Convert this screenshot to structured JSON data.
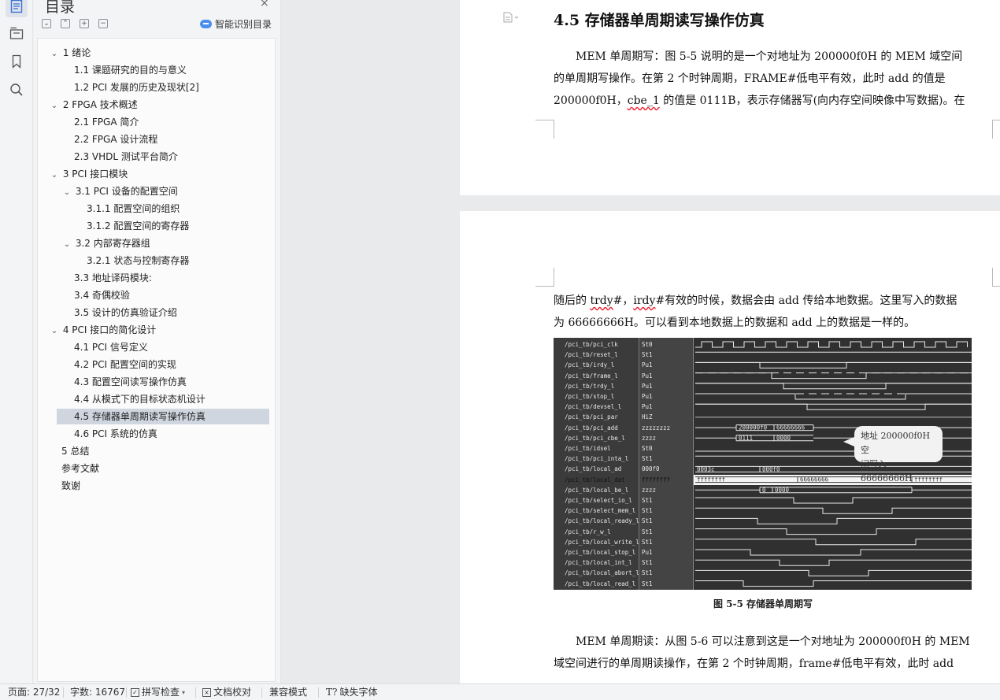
{
  "toc": {
    "title": "目录",
    "close_icon": "×",
    "smart_toc_label": "智能识别目录",
    "tools": [
      "collapse-all",
      "expand-all",
      "add-item",
      "remove-item"
    ],
    "items": [
      {
        "label": "1  绪论",
        "level": 0,
        "expanded": true
      },
      {
        "label": "1.1 课题研究的目的与意义",
        "level": 1
      },
      {
        "label": "1.2 PCI 发展的历史及现状[2]",
        "level": 1
      },
      {
        "label": "2 FPGA 技术概述",
        "level": 0,
        "expanded": true
      },
      {
        "label": "2.1 FPGA 简介",
        "level": 1
      },
      {
        "label": "2.2 FPGA 设计流程",
        "level": 1
      },
      {
        "label": "2.3 VHDL 测试平台简介",
        "level": 1
      },
      {
        "label": "3 PCI 接口模块",
        "level": 0,
        "expanded": true
      },
      {
        "label": "3.1 PCI 设备的配置空间",
        "level": 1,
        "expanded": true
      },
      {
        "label": "3.1.1  配置空间的组织",
        "level": 2
      },
      {
        "label": "3.1.2  配置空间的寄存器",
        "level": 2
      },
      {
        "label": "3.2  内部寄存器组",
        "level": 1,
        "expanded": true
      },
      {
        "label": "3.2.1 状态与控制寄存器",
        "level": 2
      },
      {
        "label": "3.3  地址译码模块:",
        "level": 1
      },
      {
        "label": "3.4    奇偶校验",
        "level": 1
      },
      {
        "label": "3.5 设计的仿真验证介绍",
        "level": 1
      },
      {
        "label": "4 PCI 接口的简化设计",
        "level": 0,
        "expanded": true
      },
      {
        "label": "4.1 PCI 信号定义",
        "level": 1
      },
      {
        "label": "4.2 PCI 配置空间的实现",
        "level": 1
      },
      {
        "label": "4.3  配置空间读写操作仿真",
        "level": 1
      },
      {
        "label": "4.4  从模式下的目标状态机设计",
        "level": 1
      },
      {
        "label": "4.5  存储器单周期读写操作仿真",
        "level": 1,
        "selected": true
      },
      {
        "label": "4.6 PCI 系统的仿真",
        "level": 1
      },
      {
        "label": "5  总结",
        "level": 0
      },
      {
        "label": "参考文献",
        "level": 0
      },
      {
        "label": "致谢",
        "level": 0
      }
    ]
  },
  "rail": {
    "icons": [
      "toc-icon",
      "navigation-icon",
      "bookmark-icon",
      "search-icon"
    ]
  },
  "doc": {
    "section_heading": "4.5  存储器单周期读写操作仿真",
    "para1": [
      "MEM 单周期写：图 5-5 说明的是一个对地址为 200000f0H 的 MEM 域空间",
      "的单周期写操作。在第 2 个时钟周期，FRAME#低电平有效，此时 add 的值是",
      "200000f0H，cbe_1 的值是  0111B，表示存储器写(向内存空间映像中写数据)。在"
    ],
    "para2": [
      "随后的 trdy#，irdy#有效的时候，数据会由 add 传给本地数据。这里写入的数据",
      "为 66666666H。可以看到本地数据上的数据和 add 上的数据是一样的。"
    ],
    "figure_caption": "图 5-5   存储器单周期写",
    "callout": [
      "地址  200000f0H  空",
      "间写入 66666666H"
    ],
    "para3": [
      "MEM 单周期读：从图 5-6 可以注意到这是一个对地址为 200000f0H 的 MEM",
      "域空间进行的单周期读操作，在第 2 个时钟周期，frame#低电平有效，此时 add"
    ],
    "signals": [
      {
        "name": "/pci_tb/pci_clk",
        "value": "St0"
      },
      {
        "name": "/pci_tb/reset_l",
        "value": "St1"
      },
      {
        "name": "/pci_tb/irdy_l",
        "value": "Pu1"
      },
      {
        "name": "/pci_tb/frame_l",
        "value": "Pu1"
      },
      {
        "name": "/pci_tb/trdy_l",
        "value": "Pu1"
      },
      {
        "name": "/pci_tb/stop_l",
        "value": "Pu1"
      },
      {
        "name": "/pci_tb/devsel_l",
        "value": "Pu1"
      },
      {
        "name": "/pci_tb/pci_par",
        "value": "HiZ"
      },
      {
        "name": "/pci_tb/pci_add",
        "value": "zzzzzzzz"
      },
      {
        "name": "/pci_tb/pci_cbe_l",
        "value": "zzzz"
      },
      {
        "name": "/pci_tb/idsel",
        "value": "St0"
      },
      {
        "name": "/pci_tb/pci_inta_l",
        "value": "St1"
      },
      {
        "name": "/pci_tb/local_ad",
        "value": "000f0"
      },
      {
        "name": "/pci_tb/local_dat",
        "value": "ffffffff",
        "highlight": true
      },
      {
        "name": "/pci_tb/local_be_l",
        "value": "zzzz"
      },
      {
        "name": "/pci_tb/select_io_l",
        "value": "St1"
      },
      {
        "name": "/pci_tb/select_mem_l",
        "value": "St1"
      },
      {
        "name": "/pci_tb/local_ready_l",
        "value": "St1"
      },
      {
        "name": "/pci_tb/r_w_l",
        "value": "St1"
      },
      {
        "name": "/pci_tb/local_write_l",
        "value": "St1"
      },
      {
        "name": "/pci_tb/local_stop_l",
        "value": "Pu1"
      },
      {
        "name": "/pci_tb/local_int_l",
        "value": "St1"
      },
      {
        "name": "/pci_tb/local_abort_l",
        "value": "St1"
      },
      {
        "name": "/pci_tb/local_read_l",
        "value": "St1"
      }
    ],
    "bus_labels": {
      "pci_add": [
        "200000f0",
        "66666666"
      ],
      "pci_cbe": [
        "0111",
        "0000"
      ],
      "local_ad": [
        "0003c",
        "000f0"
      ],
      "local_dat": [
        "ffffffff",
        "66666666",
        "ffffffff"
      ],
      "local_be": [
        "0",
        "0000"
      ]
    }
  },
  "status": {
    "page": "页面: 27/32",
    "words": "字数: 16767",
    "spell_check": "拼写检查",
    "doc_check": "文档校对",
    "compat_mode": "兼容模式",
    "missing_font": "缺失字体"
  }
}
